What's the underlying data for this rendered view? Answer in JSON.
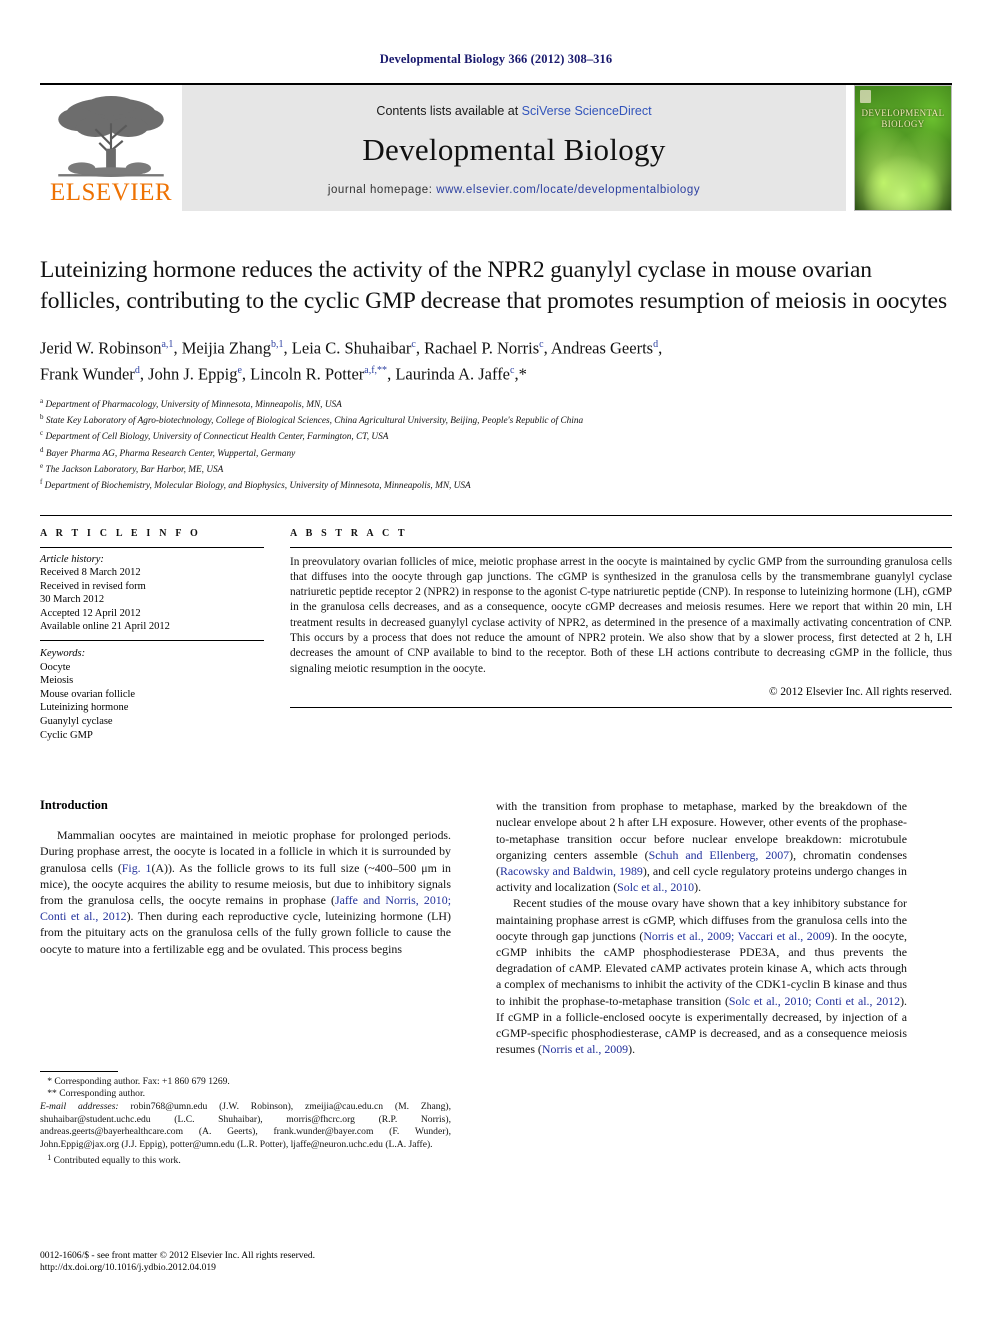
{
  "running_head": "Developmental Biology 366 (2012) 308–316",
  "masthead": {
    "publisher_word": "ELSEVIER",
    "contents_prefix": "Contents lists available at ",
    "contents_link": "SciVerse ScienceDirect",
    "journal_name": "Developmental Biology",
    "homepage_prefix": "journal homepage: ",
    "homepage_url": "www.elsevier.com/locate/developmentalbiology",
    "cover_title_line1": "DEVELOPMENTAL",
    "cover_title_line2": "BIOLOGY"
  },
  "article": {
    "title": "Luteinizing hormone reduces the activity of the NPR2 guanylyl cyclase in mouse ovarian follicles, contributing to the cyclic GMP decrease that promotes resumption of meiosis in oocytes",
    "authors_line1": "Jerid W. Robinson a,1, Meijia Zhang b,1, Leia C. Shuhaibar c, Rachael P. Norris c, Andreas Geerts d,",
    "authors_line2": "Frank Wunder d, John J. Eppig e, Lincoln R. Potter a,f,**, Laurinda A. Jaffe c,*",
    "affiliations": [
      {
        "mark": "a",
        "text": "Department of Pharmacology, University of Minnesota, Minneapolis, MN, USA"
      },
      {
        "mark": "b",
        "text": "State Key Laboratory of Agro-biotechnology, College of Biological Sciences, China Agricultural University, Beijing, People's Republic of China"
      },
      {
        "mark": "c",
        "text": "Department of Cell Biology, University of Connecticut Health Center, Farmington, CT, USA"
      },
      {
        "mark": "d",
        "text": "Bayer Pharma AG, Pharma Research Center, Wuppertal, Germany"
      },
      {
        "mark": "e",
        "text": "The Jackson Laboratory, Bar Harbor, ME, USA"
      },
      {
        "mark": "f",
        "text": "Department of Biochemistry, Molecular Biology, and Biophysics, University of Minnesota, Minneapolis, MN, USA"
      }
    ]
  },
  "article_info": {
    "heading": "A R T I C L E   I N F O",
    "history_label": "Article history:",
    "history": [
      "Received 8 March 2012",
      "Received in revised form",
      "30 March 2012",
      "Accepted 12 April 2012",
      "Available online 21 April 2012"
    ],
    "keywords_label": "Keywords:",
    "keywords": [
      "Oocyte",
      "Meiosis",
      "Mouse ovarian follicle",
      "Luteinizing hormone",
      "Guanylyl cyclase",
      "Cyclic GMP"
    ]
  },
  "abstract": {
    "heading": "A B S T R A C T",
    "text": "In preovulatory ovarian follicles of mice, meiotic prophase arrest in the oocyte is maintained by cyclic GMP from the surrounding granulosa cells that diffuses into the oocyte through gap junctions. The cGMP is synthesized in the granulosa cells by the transmembrane guanylyl cyclase natriuretic peptide receptor 2 (NPR2) in response to the agonist C-type natriuretic peptide (CNP). In response to luteinizing hormone (LH), cGMP in the granulosa cells decreases, and as a consequence, oocyte cGMP decreases and meiosis resumes. Here we report that within 20 min, LH treatment results in decreased guanylyl cyclase activity of NPR2, as determined in the presence of a maximally activating concentration of CNP. This occurs by a process that does not reduce the amount of NPR2 protein. We also show that by a slower process, first detected at 2 h, LH decreases the amount of CNP available to bind to the receptor. Both of these LH actions contribute to decreasing cGMP in the follicle, thus signaling meiotic resumption in the oocyte.",
    "copyright": "© 2012 Elsevier Inc. All rights reserved."
  },
  "body": {
    "intro_heading": "Introduction",
    "left_paragraphs": [
      "Mammalian oocytes are maintained in meiotic prophase for prolonged periods. During prophase arrest, the oocyte is located in a follicle in which it is surrounded by granulosa cells (Fig. 1(A)). As the follicle grows to its full size (~400–500 μm in mice), the oocyte acquires the ability to resume meiosis, but due to inhibitory signals from the granulosa cells, the oocyte remains in prophase (Jaffe and Norris, 2010; Conti et al., 2012). Then during each reproductive cycle, luteinizing hormone (LH) from the pituitary acts on the granulosa cells of the fully grown follicle to cause the oocyte to mature into a fertilizable egg and be ovulated. This process begins"
    ],
    "right_paragraphs": [
      "with the transition from prophase to metaphase, marked by the breakdown of the nuclear envelope about 2 h after LH exposure. However, other events of the prophase-to-metaphase transition occur before nuclear envelope breakdown: microtubule organizing centers assemble (Schuh and Ellenberg, 2007), chromatin condenses (Racowsky and Baldwin, 1989), and cell cycle regulatory proteins undergo changes in activity and localization (Solc et al., 2010).",
      "Recent studies of the mouse ovary have shown that a key inhibitory substance for maintaining prophase arrest is cGMP, which diffuses from the granulosa cells into the oocyte through gap junctions (Norris et al., 2009; Vaccari et al., 2009). In the oocyte, cGMP inhibits the cAMP phosphodiesterase PDE3A, and thus prevents the degradation of cAMP. Elevated cAMP activates protein kinase A, which acts through a complex of mechanisms to inhibit the activity of the CDK1-cyclin B kinase and thus to inhibit the prophase-to-metaphase transition (Solc et al., 2010; Conti et al., 2012). If cGMP in a follicle-enclosed oocyte is experimentally decreased, by injection of a cGMP-specific phosphodiesterase, cAMP is decreased, and as a consequence meiosis resumes (Norris et al., 2009)."
    ]
  },
  "footnotes": {
    "corresponding_1": "Corresponding author. Fax: +1 860 679 1269.",
    "corresponding_2": "Corresponding author.",
    "email_label": "E-mail addresses:",
    "emails": "robin768@umn.edu (J.W. Robinson), zmeijia@cau.edu.cn (M. Zhang), shuhaibar@student.uchc.edu (L.C. Shuhaibar), morris@fhcrc.org (R.P. Norris), andreas.geerts@bayerhealthcare.com (A. Geerts), frank.wunder@bayer.com (F. Wunder), John.Eppig@jax.org (J.J. Eppig), potter@umn.edu (L.R. Potter), ljaffe@neuron.uchc.edu (L.A. Jaffe).",
    "equal_contribution": "Contributed equally to this work.",
    "issn_line": "0012-1606/$ - see front matter © 2012 Elsevier Inc. All rights reserved.",
    "doi_line": "http://dx.doi.org/10.1016/j.ydbio.2012.04.019"
  }
}
